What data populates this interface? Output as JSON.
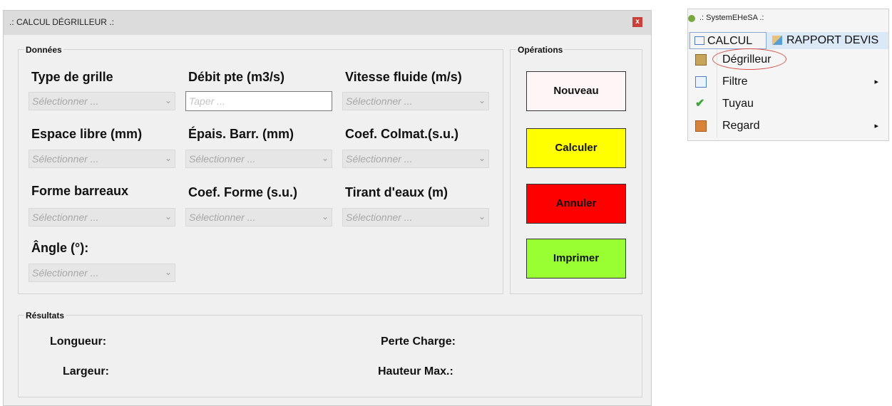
{
  "window": {
    "title": ".: CALCUL DÉGRILLEUR .:",
    "close_glyph": "x"
  },
  "donnees": {
    "group_label": "Données",
    "fields": [
      {
        "label": "Type de grille",
        "value": "Sélectionner ..."
      },
      {
        "label": "Débit pte (m3/s)",
        "placeholder": "Taper ..."
      },
      {
        "label": "Vitesse fluide (m/s)",
        "value": "Sélectionner ..."
      },
      {
        "label": "Espace libre (mm)",
        "value": "Sélectionner ..."
      },
      {
        "label": "Épais. Barr. (mm)",
        "value": "Sélectionner ..."
      },
      {
        "label": "Coef. Colmat.(s.u.)",
        "value": "Sélectionner ..."
      },
      {
        "label": "Forme barreaux",
        "value": "Sélectionner ..."
      },
      {
        "label": "Coef. Forme (s.u.)",
        "value": "Sélectionner ..."
      },
      {
        "label": "Tirant d'eaux (m)",
        "value": "Sélectionner ..."
      },
      {
        "label": "Ângle (°):",
        "value": "Sélectionner ..."
      }
    ]
  },
  "operations": {
    "group_label": "Opérations",
    "buttons": [
      {
        "label": "Nouveau",
        "color": "#fdf5f6"
      },
      {
        "label": "Calculer",
        "color": "#ffff00"
      },
      {
        "label": "Annuler",
        "color": "#ff0000"
      },
      {
        "label": "Imprimer",
        "color": "#99ff33"
      }
    ]
  },
  "resultats": {
    "group_label": "Résultats",
    "labels": [
      "Longueur:",
      "Largeur:",
      "Perte Charge:",
      "Hauteur Max.:"
    ]
  },
  "menu": {
    "app_title": ".: SystemEHeSA .:",
    "tabs": [
      "CALCUL",
      "RAPPORT DEVIS"
    ],
    "items": [
      {
        "label": "Dégrilleur",
        "icon": "degrilleur-icon",
        "submenu": false
      },
      {
        "label": "Filtre",
        "icon": "filtre-icon",
        "submenu": true
      },
      {
        "label": "Tuyau",
        "icon": "check-icon",
        "submenu": false
      },
      {
        "label": "Regard",
        "icon": "regard-icon",
        "submenu": true
      }
    ],
    "submenu_glyph": "▸",
    "combo_arrow_glyph": "⌄",
    "highlight_color": "#d9534f"
  }
}
